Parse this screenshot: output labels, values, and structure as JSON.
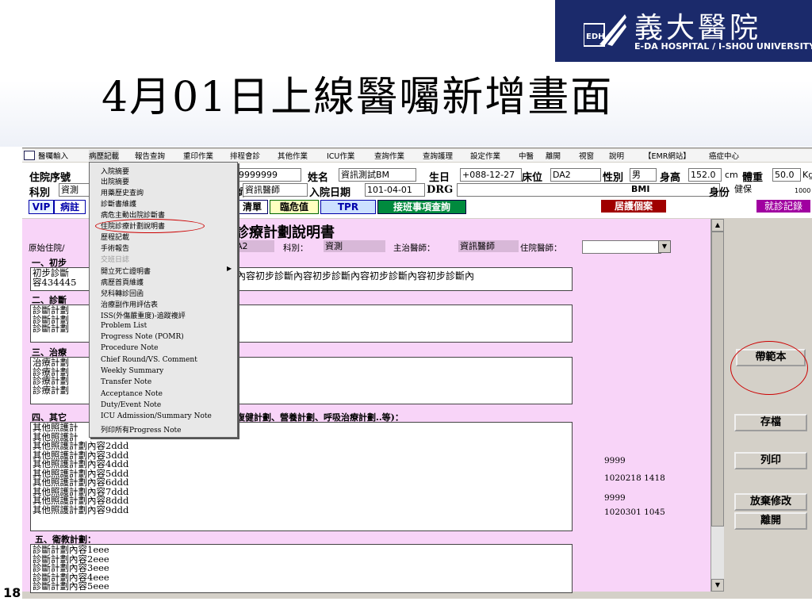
{
  "slide": {
    "title": "4月01日上線醫囑新增畫面",
    "hospital_name": "義大醫院",
    "hospital_en": "E-DA HOSPITAL / I-SHOU UNIVERSITY",
    "logo_text": "EDH",
    "slide_number": "18"
  },
  "menubar": {
    "items": [
      "醫囑輸入",
      "病歷記載",
      "報告查詢",
      "重印作業",
      "排程會診",
      "其他作業",
      "ICU作業",
      "查詢作業",
      "查詢護理",
      "設定作業",
      "中醫",
      "離開",
      "視窗",
      "說明",
      "【EMR網站】",
      "癌症中心"
    ]
  },
  "dropdown": {
    "items": [
      "入院摘要",
      "出院摘要",
      "用藥歷史查詢",
      "診斷書維護",
      "病危主動出院診斷書",
      "住院診療計劃說明書",
      "歷程記載",
      "手術報告",
      "交班日誌",
      "開立死亡證明書",
      "病歷首頁維護",
      "兒科轉診回函",
      "治療副作用評估表",
      "ISS(外傷嚴重度)-追蹤複評",
      "Problem List",
      "Progress Note (POMR)",
      "Procedure Note",
      "Chief Round/VS. Comment",
      "Weekly Summary",
      "Transfer Note",
      "Acceptance Note",
      "Duty/Event Note",
      "ICU Admission/Summary Note",
      "列印所有Progress Note"
    ]
  },
  "patient": {
    "admit_no_label": "住院序號",
    "dept_label": "科別",
    "dept_value": "資測",
    "chart_no_suffix": "號",
    "chart_no_value": "9999999",
    "name_label": "姓名",
    "name_value": "資訊測試BM",
    "birth_label": "生日",
    "birth_value": "+088-12-27",
    "bed_label": "床位",
    "bed_value": "DA2",
    "sex_label": "性別",
    "sex_value": "男",
    "height_label": "身高",
    "height_value": "152.0",
    "height_unit": "cm",
    "weight_label": "體重",
    "weight_value": "50.0",
    "weight_unit": "Kg",
    "doctor_suffix": "師",
    "doctor_value": "資訊醫師",
    "admit_date_label": "入院日期",
    "admit_date_value": "101-04-01",
    "drg_label": "DRG",
    "bmi_label": "BMI",
    "identity_label": "身份",
    "identity_value": "健保",
    "identity_code": "1000"
  },
  "buttons": {
    "vip": "VIP",
    "disease_note": "病註",
    "order_list": "清單",
    "critical_value": "臨危值",
    "tpr": "TPR",
    "handover_query": "接班事項查詢",
    "home_care": "居護個案",
    "visit_record": "就診記錄",
    "template": "帶範本",
    "save": "存檔",
    "print": "列印",
    "discard": "放棄修改",
    "leave": "離開"
  },
  "form": {
    "title": "診療計劃說明書",
    "origin_label": "原始住院/",
    "bed_value": "A2",
    "dept_label": "科別：",
    "dept_value": "資測",
    "attending_label": "主治醫師：",
    "attending_value": "資訊醫師",
    "resident_label": "住院醫師：",
    "sec1": "一、初步",
    "sec1_lines": [
      "初步診斷",
      "容434445"
    ],
    "sec1_right": "內容初步診斷內容初步診斷內容初步診斷內容初步診斷內",
    "sec2": "二、診斷",
    "sec2_lines": [
      "診斷計劃",
      "診斷計劃",
      "診斷計劃"
    ],
    "sec3": "三、治療",
    "sec3_lines": [
      "治療計劃",
      "診療計劃",
      "診療計劃",
      "診療計劃"
    ],
    "sec4": "四、其它",
    "sec4_tail": "復健計劃、營養計劃、呼吸治療計劃..等)：",
    "sec4_lines": [
      "其他照護計",
      "其他照護計",
      "其他照護計劃內容2ddd",
      "其他照護計劃內容3ddd",
      "其他照護計劃內容4ddd",
      "其他照護計劃內容5ddd",
      "其他照護計劃內容6ddd",
      "其他照護計劃內容7ddd",
      "其他照護計劃內容8ddd",
      "其他照護計劃內容9ddd"
    ],
    "sec5": "五、衛教計劃：",
    "sec5_lines": [
      "診斷計劃內容1eee",
      "診斷計劃內容2eee",
      "診斷計劃內容3eee",
      "診斷計劃內容4eee",
      "診斷計劃內容5eee"
    ],
    "notes": {
      "n1": "9999",
      "n2": "1020218  1418",
      "n3": "9999",
      "n4": "1020301  1045"
    }
  }
}
